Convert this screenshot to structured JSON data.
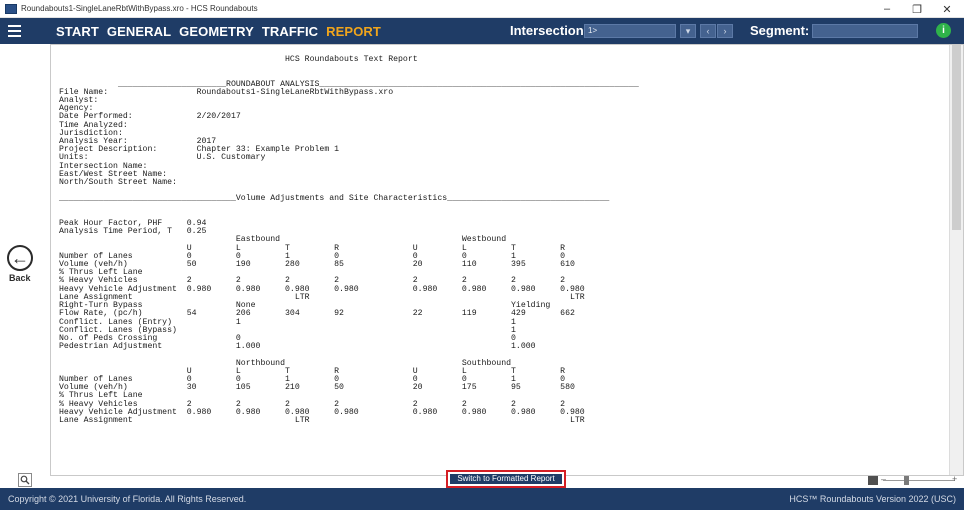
{
  "window": {
    "title": "Roundabouts1-SingleLaneRbtWithBypass.xro - HCS Roundabouts"
  },
  "menu": {
    "items": [
      {
        "label": "START",
        "active": false
      },
      {
        "label": "GENERAL",
        "active": false
      },
      {
        "label": "GEOMETRY",
        "active": false
      },
      {
        "label": "TRAFFIC",
        "active": false
      },
      {
        "label": "REPORT",
        "active": true
      }
    ],
    "intersection_label": "Intersection:",
    "intersection_value": "1>",
    "segment_label": "Segment:",
    "segment_value": ""
  },
  "back": {
    "label": "Back"
  },
  "report": {
    "title": "HCS Roundabouts Text Report",
    "section_roundabout": "ROUNDABOUT ANALYSIS",
    "info": [
      {
        "label": "File Name:",
        "value": "Roundabouts1-SingleLaneRbtWithBypass.xro"
      },
      {
        "label": "Analyst:",
        "value": ""
      },
      {
        "label": "Agency:",
        "value": ""
      },
      {
        "label": "Date Performed:",
        "value": "2/20/2017"
      },
      {
        "label": "Time Analyzed:",
        "value": ""
      },
      {
        "label": "Jurisdiction:",
        "value": ""
      },
      {
        "label": "Analysis Year:",
        "value": "2017"
      },
      {
        "label": "Project Description:",
        "value": "Chapter 33: Example Problem 1"
      },
      {
        "label": "Units:",
        "value": "U.S. Customary"
      },
      {
        "label": "Intersection Name:",
        "value": ""
      },
      {
        "label": "East/West Street Name:",
        "value": ""
      },
      {
        "label": "North/South Street Name:",
        "value": ""
      }
    ],
    "section_volume": "Volume Adjustments and Site Characteristics",
    "phf_label": "Peak Hour Factor, PHF",
    "phf_value": "0.94",
    "atp_label": "Analysis Time Period, T",
    "atp_value": "0.25",
    "approach_ew": {
      "left": "Eastbound",
      "right": "Westbound"
    },
    "approach_ns": {
      "left": "Northbound",
      "right": "Southbound"
    },
    "movements": [
      "U",
      "L",
      "T",
      "R",
      "U",
      "L",
      "T",
      "R"
    ],
    "rows_ew": [
      {
        "label": "Number of Lanes",
        "values": [
          "0",
          "0",
          "1",
          "0",
          "0",
          "0",
          "1",
          "0"
        ]
      },
      {
        "label": "Volume (veh/h)",
        "values": [
          "50",
          "190",
          "280",
          "85",
          "20",
          "110",
          "395",
          "610"
        ]
      },
      {
        "label": "% Thrus Left Lane",
        "values": [
          "",
          "",
          "",
          "",
          "",
          "",
          "",
          ""
        ]
      },
      {
        "label": "% Heavy Vehicles",
        "values": [
          "2",
          "2",
          "2",
          "2",
          "2",
          "2",
          "2",
          "2"
        ]
      },
      {
        "label": "Heavy Vehicle Adjustment",
        "values": [
          "0.980",
          "0.980",
          "0.980",
          "0.980",
          "0.980",
          "0.980",
          "0.980",
          "0.980"
        ]
      },
      {
        "label": "Lane Assignment",
        "eb": "LTR",
        "wb": "LTR"
      },
      {
        "label": "Right-Turn Bypass",
        "eb": "None",
        "wb": "Yielding"
      },
      {
        "label": "Flow Rate, (pc/h)",
        "values": [
          "54",
          "206",
          "304",
          "92",
          "22",
          "119",
          "429",
          "662"
        ]
      },
      {
        "label": "Conflict. Lanes (Entry)",
        "eb": "1",
        "wb": "1"
      },
      {
        "label": "Conflict. Lanes (Bypass)",
        "eb": "",
        "wb": "1"
      },
      {
        "label": "No. of Peds Crossing",
        "eb": "0",
        "wb": "0"
      },
      {
        "label": "Pedestrian Adjustment",
        "eb": "1.000",
        "wb": "1.000"
      }
    ],
    "rows_ns": [
      {
        "label": "Number of Lanes",
        "values": [
          "0",
          "0",
          "1",
          "0",
          "0",
          "0",
          "1",
          "0"
        ]
      },
      {
        "label": "Volume (veh/h)",
        "values": [
          "30",
          "105",
          "210",
          "50",
          "20",
          "175",
          "95",
          "580"
        ]
      },
      {
        "label": "% Thrus Left Lane",
        "values": [
          "",
          "",
          "",
          "",
          "",
          "",
          "",
          ""
        ]
      },
      {
        "label": "% Heavy Vehicles",
        "values": [
          "2",
          "2",
          "2",
          "2",
          "2",
          "2",
          "2",
          "2"
        ]
      },
      {
        "label": "Heavy Vehicle Adjustment",
        "values": [
          "0.980",
          "0.980",
          "0.980",
          "0.980",
          "0.980",
          "0.980",
          "0.980",
          "0.980"
        ]
      },
      {
        "label": "Lane Assignment",
        "eb": "LTR",
        "wb": "LTR"
      }
    ]
  },
  "toolbar": {
    "switch_label": "Switch to Formatted Report"
  },
  "status": {
    "copyright": "Copyright © 2021 University of Florida. All Rights Reserved.",
    "version": "HCS™ Roundabouts Version 2022 (USC)"
  },
  "colors": {
    "navy": "#1f3c66",
    "active_menu": "#f0a51c",
    "highlight_border": "#d41e24",
    "info_green": "#2fb34a"
  }
}
